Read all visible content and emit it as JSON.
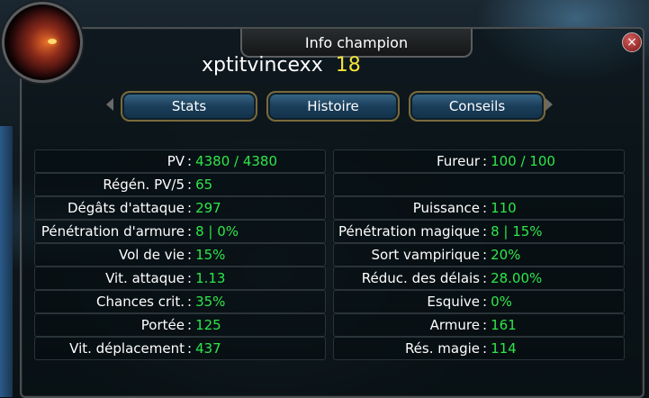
{
  "window": {
    "title": "Info champion",
    "close_label": "×"
  },
  "champion": {
    "name": "xptitvincexx",
    "level": "18"
  },
  "tabs": [
    {
      "label": "Stats"
    },
    {
      "label": "Histoire"
    },
    {
      "label": "Conseils"
    }
  ],
  "stats_left": [
    {
      "label": "PV",
      "value": "4380 / 4380"
    },
    {
      "label": "Régén. PV/5",
      "value": "65"
    },
    {
      "label": "Dégâts d'attaque",
      "value": "297"
    },
    {
      "label": "Pénétration d'armure",
      "value": "8 | 0%"
    },
    {
      "label": "Vol de vie",
      "value": "15%"
    },
    {
      "label": "Vit. attaque",
      "value": "1.13"
    },
    {
      "label": "Chances crit.",
      "value": "35%"
    },
    {
      "label": "Portée",
      "value": "125"
    },
    {
      "label": "Vit. déplacement",
      "value": "437"
    }
  ],
  "stats_right": [
    {
      "label": "Fureur",
      "value": "100 / 100"
    },
    {
      "label": "",
      "value": ""
    },
    {
      "label": "Puissance",
      "value": "110"
    },
    {
      "label": "Pénétration magique",
      "value": "8 | 15%"
    },
    {
      "label": "Sort vampirique",
      "value": "20%"
    },
    {
      "label": "Réduc. des délais",
      "value": "28.00%"
    },
    {
      "label": "Esquive",
      "value": "0%"
    },
    {
      "label": "Armure",
      "value": "161"
    },
    {
      "label": "Rés. magie",
      "value": "114"
    }
  ],
  "colors": {
    "value_green": "#2ee64a",
    "level_yellow": "#f2e23a",
    "label_white": "#ffffff"
  },
  "icons": {
    "close": "close-icon",
    "portrait": "champion-portrait"
  }
}
